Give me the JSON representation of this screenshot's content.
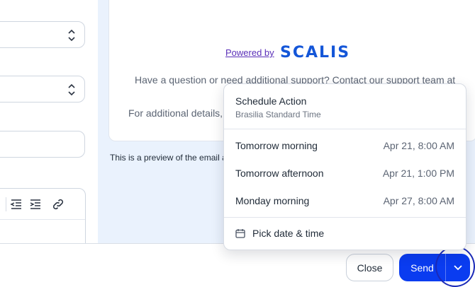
{
  "preview": {
    "powered_by": "Powered by",
    "logo": "SCALIS",
    "help_text": "Have a question or need additional support? Contact our support team at",
    "details_text": "For additional details, p",
    "note": "This is a preview of the email a"
  },
  "footer": {
    "close_label": "Close",
    "send_label": "Send"
  },
  "schedule": {
    "title": "Schedule Action",
    "timezone": "Brasilia Standard Time",
    "options": [
      {
        "label": "Tomorrow morning",
        "time": "Apr 21, 8:00 AM"
      },
      {
        "label": "Tomorrow afternoon",
        "time": "Apr 21, 1:00 PM"
      },
      {
        "label": "Monday morning",
        "time": "Apr 27, 8:00 AM"
      }
    ],
    "pick_label": "Pick date & time"
  },
  "icons": {
    "select_chevron": "chevron-up-down-icon",
    "outdent": "outdent-icon",
    "indent": "indent-icon",
    "link": "link-icon",
    "calendar": "calendar-icon",
    "dropdown_toggle": "chevron-down-icon"
  },
  "colors": {
    "primary": "#0a3cf0",
    "logo": "#1456d8",
    "powered_by_link": "#5a2fb8",
    "preview_background": "#eaf2fd",
    "focus_ring": "#1b2ab8"
  }
}
